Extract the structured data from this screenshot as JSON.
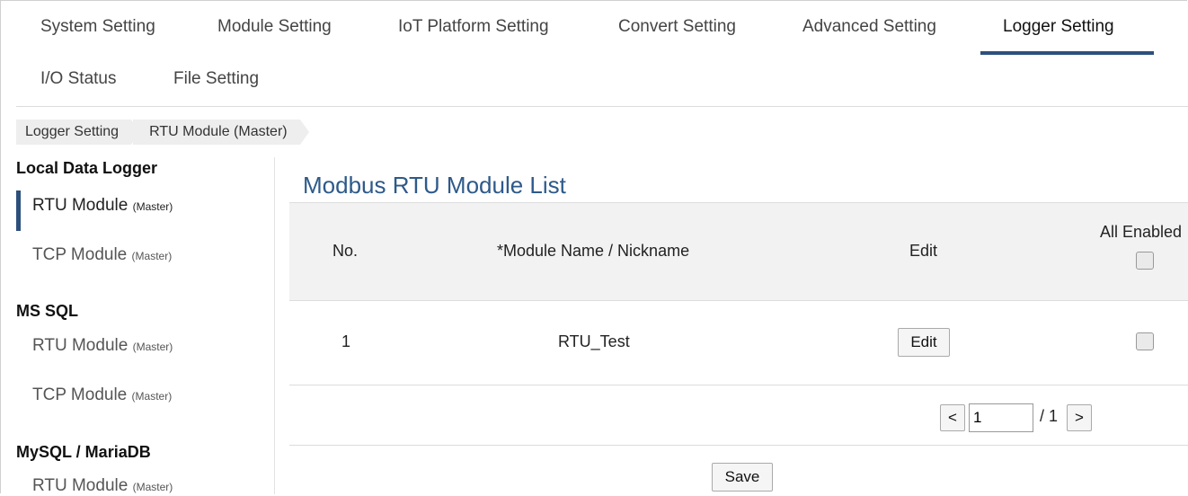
{
  "nav": {
    "tabs": [
      {
        "label": "System Setting"
      },
      {
        "label": "Module Setting"
      },
      {
        "label": "IoT Platform Setting"
      },
      {
        "label": "Convert Setting"
      },
      {
        "label": "Advanced Setting"
      },
      {
        "label": "Logger Setting"
      },
      {
        "label": "I/O Status"
      },
      {
        "label": "File Setting"
      }
    ],
    "active_tab": "Logger Setting"
  },
  "breadcrumb": [
    "Logger Setting",
    "RTU Module (Master)"
  ],
  "sidebar": {
    "sections": [
      {
        "title": "Local Data Logger",
        "items": [
          {
            "label": "RTU Module",
            "sub": "(Master)"
          },
          {
            "label": "TCP Module",
            "sub": "(Master)"
          }
        ]
      },
      {
        "title": "MS SQL",
        "items": [
          {
            "label": "RTU Module",
            "sub": "(Master)"
          },
          {
            "label": "TCP Module",
            "sub": "(Master)"
          }
        ]
      },
      {
        "title": "MySQL / MariaDB",
        "items": [
          {
            "label": "RTU Module",
            "sub": "(Master)"
          }
        ]
      }
    ],
    "active_item": "Local Data Logger / RTU Module"
  },
  "main": {
    "title": "Modbus RTU Module List",
    "columns": {
      "no": "No.",
      "name": "*Module Name / Nickname",
      "edit": "Edit",
      "enabled": "All Enabled"
    },
    "rows": [
      {
        "no": "1",
        "name": "RTU_Test",
        "edit_label": "Edit",
        "enabled": false
      }
    ],
    "all_enabled": false,
    "pagination": {
      "prev": "<",
      "current": "1",
      "total": "/ 1",
      "next": ">"
    },
    "save_label": "Save"
  },
  "colors": {
    "accent": "#2d4f7c",
    "title": "#2d5a8a",
    "header_bg": "#f2f2f2"
  }
}
